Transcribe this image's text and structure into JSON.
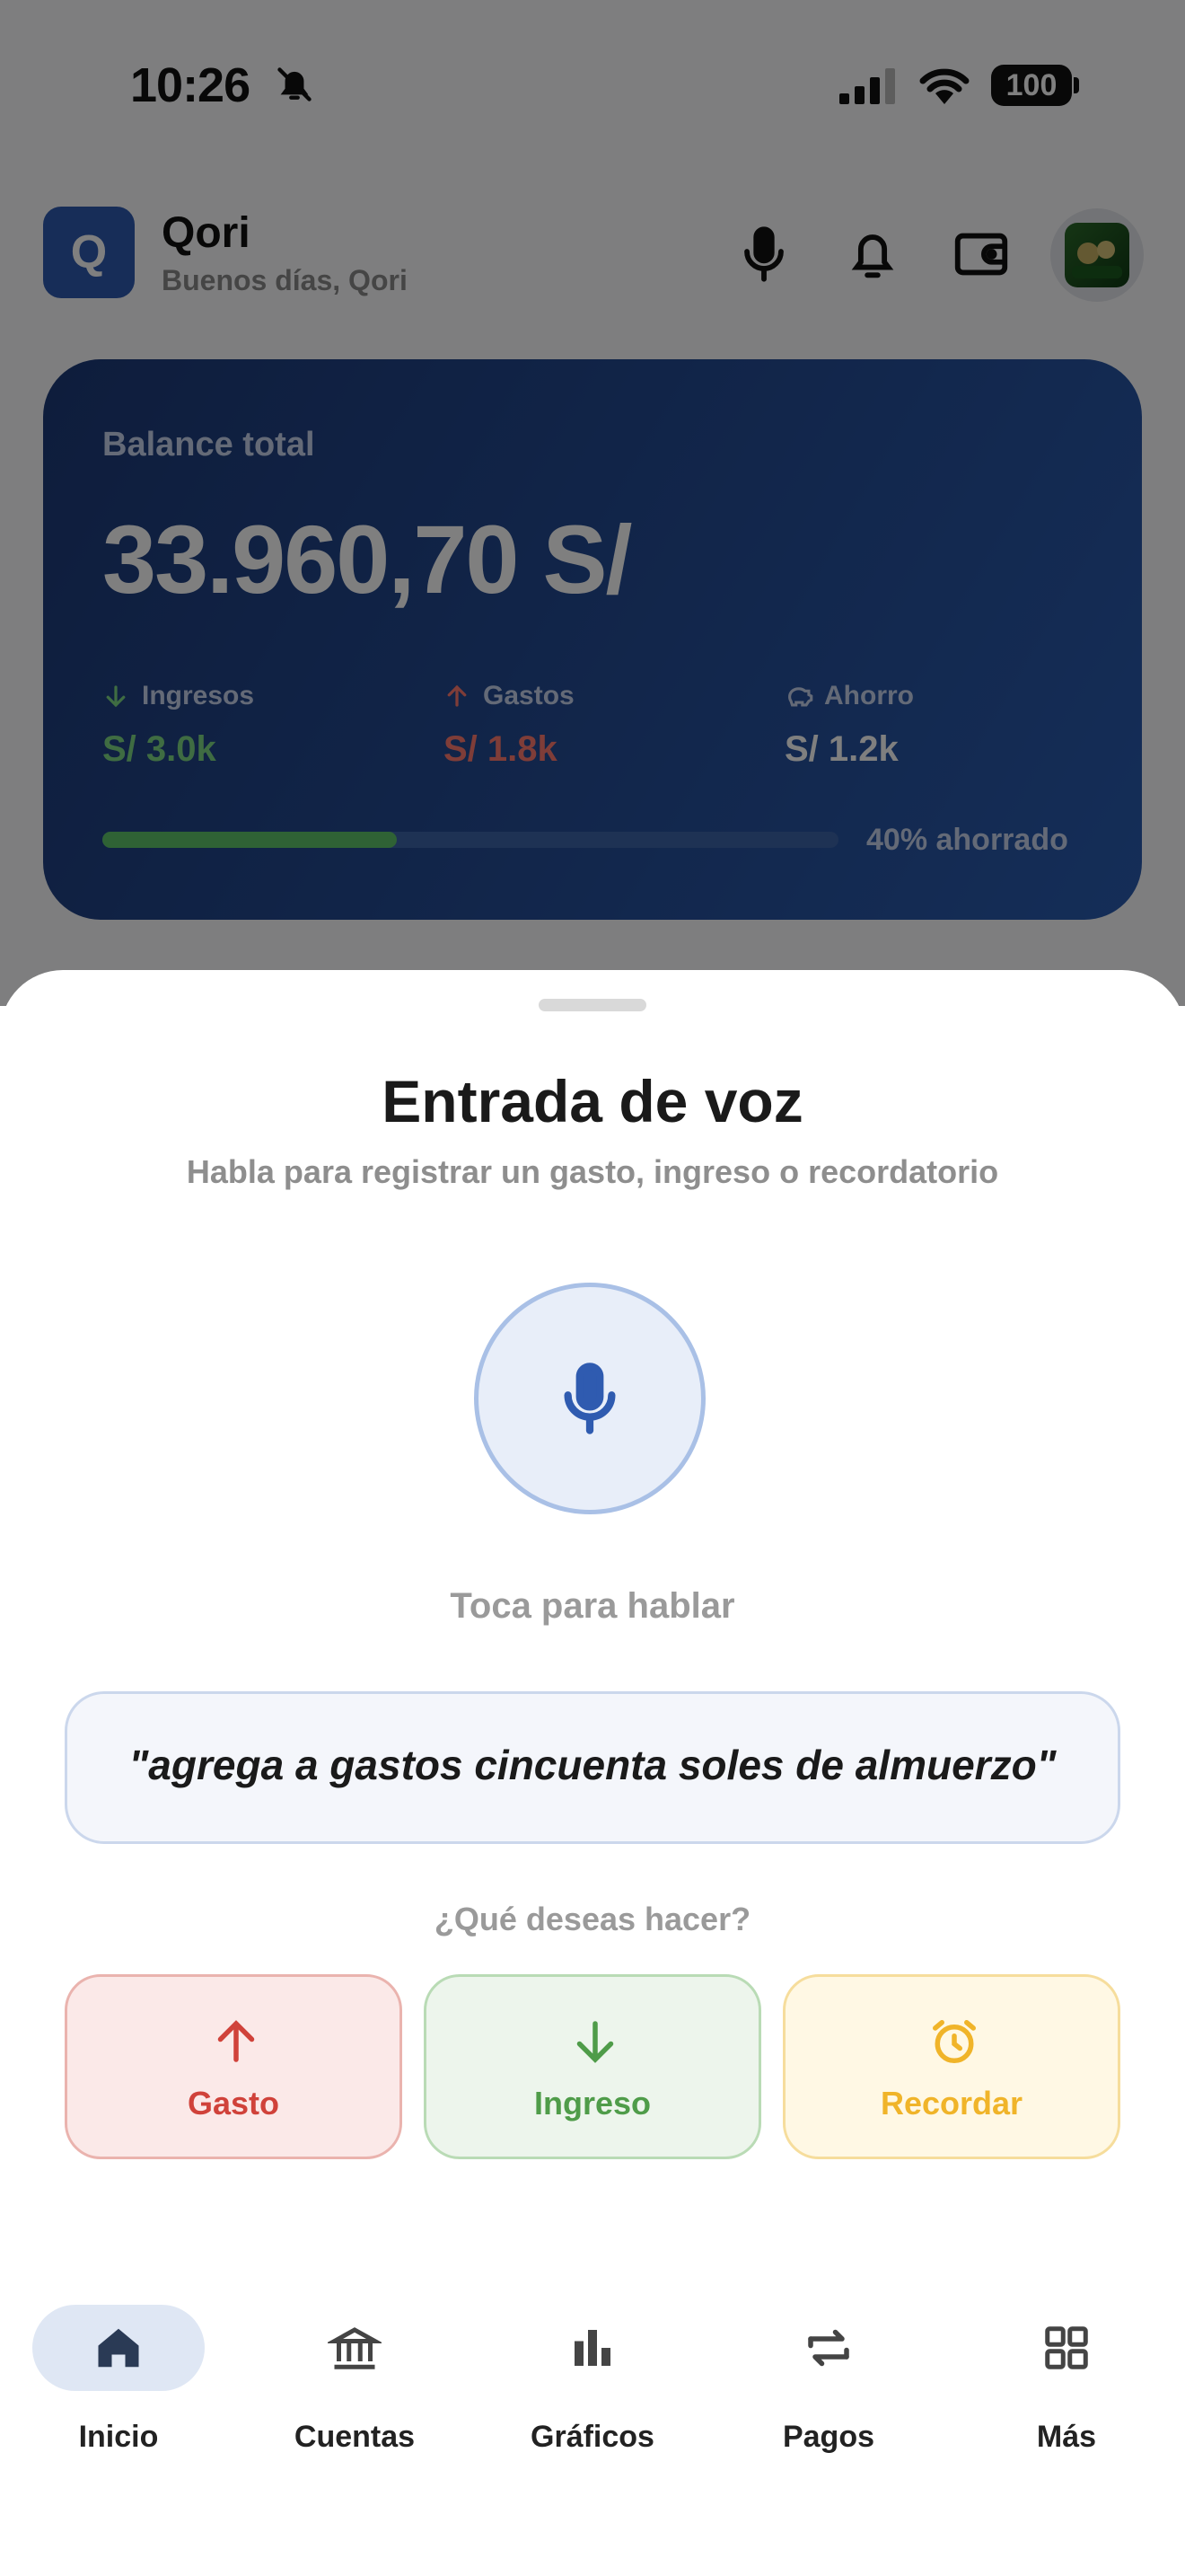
{
  "status_bar": {
    "time": "10:26",
    "battery": "100"
  },
  "header": {
    "app_name": "Qori",
    "logo_letter": "Q",
    "greeting": "Buenos días, Qori"
  },
  "balance": {
    "label": "Balance total",
    "amount": "33.960,70 S/",
    "income_label": "Ingresos",
    "income_value": "S/ 3.0k",
    "expense_label": "Gastos",
    "expense_value": "S/ 1.8k",
    "savings_label": "Ahorro",
    "savings_value": "S/ 1.2k",
    "saved_fraction": 0.4,
    "saved_label": "40% ahorrado"
  },
  "voice_sheet": {
    "title": "Entrada de voz",
    "subtitle": "Habla para registrar un gasto, ingreso o recordatorio",
    "mic_hint": "Toca para hablar",
    "example_phrase": "\"agrega a gastos cincuenta soles de almuerzo\"",
    "question": "¿Qué deseas hacer?",
    "actions": [
      {
        "label": "Gasto",
        "icon": "arrow-up-icon",
        "color": "#d0423a"
      },
      {
        "label": "Ingreso",
        "icon": "arrow-down-icon",
        "color": "#4f9c49"
      },
      {
        "label": "Recordar",
        "icon": "alarm-clock-icon",
        "color": "#f0b429"
      }
    ]
  },
  "nav": {
    "items": [
      {
        "label": "Inicio",
        "icon": "home-icon",
        "active": true
      },
      {
        "label": "Cuentas",
        "icon": "bank-icon",
        "active": false
      },
      {
        "label": "Gráficos",
        "icon": "bar-chart-icon",
        "active": false
      },
      {
        "label": "Pagos",
        "icon": "transfer-icon",
        "active": false
      },
      {
        "label": "Más",
        "icon": "grid-icon",
        "active": false
      }
    ]
  },
  "colors": {
    "accent": "#2f5bb0",
    "income": "#5fc46b",
    "expense": "#e0554a"
  }
}
